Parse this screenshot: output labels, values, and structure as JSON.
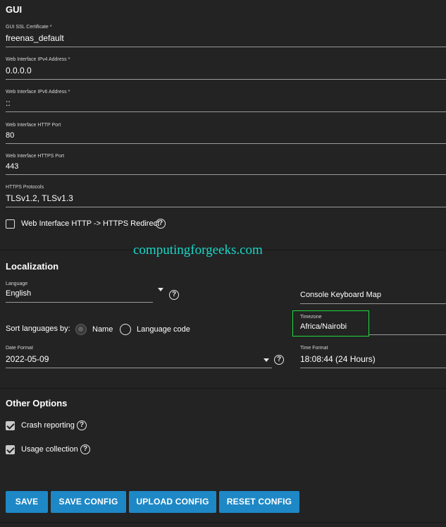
{
  "gui": {
    "title": "GUI",
    "ssl_cert": {
      "label": "GUI SSL Certificate *",
      "value": "freenas_default"
    },
    "ipv4": {
      "label": "Web Interface IPv4 Address *",
      "value": "0.0.0.0"
    },
    "ipv6": {
      "label": "Web Interface IPv6 Address *",
      "value": "::"
    },
    "http_port": {
      "label": "Web Interface HTTP Port",
      "value": "80"
    },
    "https_port": {
      "label": "Web Interface HTTPS Port",
      "value": "443"
    },
    "https_protocols": {
      "label": "HTTPS Protocols",
      "value": "TLSv1.2, TLSv1.3"
    },
    "redirect": {
      "label": "Web Interface HTTP -> HTTPS Redirect",
      "checked": false
    }
  },
  "watermark": "computingforgeeks.com",
  "localization": {
    "title": "Localization",
    "language": {
      "label": "Language",
      "value": "English"
    },
    "console_keyboard_map": {
      "label": "Console Keyboard Map"
    },
    "sort_languages": {
      "label": "Sort languages by:",
      "options": [
        "Name",
        "Language code"
      ],
      "selected": "Name"
    },
    "timezone": {
      "label": "Timezone",
      "value": "Africa/Nairobi"
    },
    "date_format": {
      "label": "Date Format",
      "value": "2022-05-09"
    },
    "time_format": {
      "label": "Time Format",
      "value": "18:08:44 (24 Hours)"
    }
  },
  "other_options": {
    "title": "Other Options",
    "crash_reporting": {
      "label": "Crash reporting",
      "checked": true
    },
    "usage_collection": {
      "label": "Usage collection",
      "checked": true
    }
  },
  "buttons": {
    "save": "SAVE",
    "save_config": "SAVE CONFIG",
    "upload_config": "UPLOAD CONFIG",
    "reset_config": "RESET CONFIG"
  },
  "icons": {
    "help": "?"
  },
  "colors": {
    "accent": "#1e88c6",
    "highlight": "#1fdc40",
    "watermark": "#18d9c9",
    "background": "#232323"
  }
}
